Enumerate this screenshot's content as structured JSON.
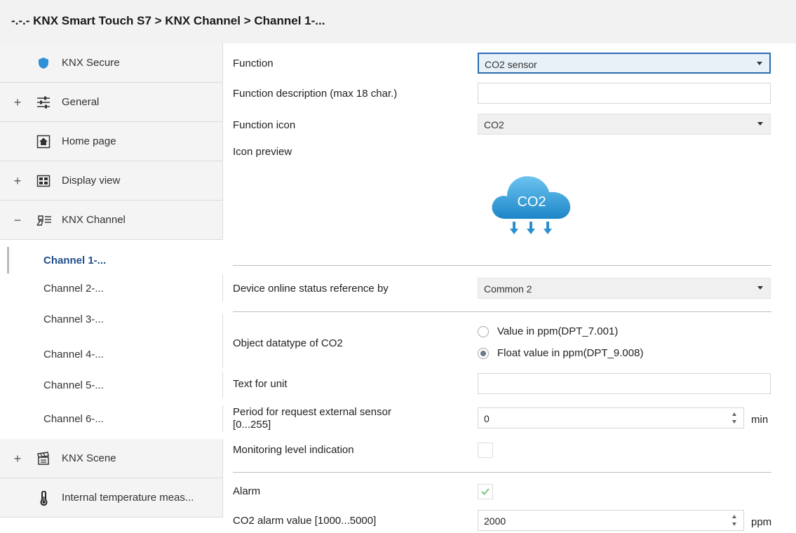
{
  "breadcrumb": "-.-.- KNX Smart Touch S7 > KNX Channel  > Channel 1-...",
  "sidebar": {
    "items": [
      {
        "label": "KNX Secure",
        "expander": ""
      },
      {
        "label": "General",
        "expander": "+"
      },
      {
        "label": "Home page",
        "expander": ""
      },
      {
        "label": "Display view",
        "expander": "+"
      },
      {
        "label": "KNX Channel",
        "expander": "−"
      }
    ],
    "channels": [
      "Channel 1-...",
      "Channel 2-...",
      "Channel 3-...",
      "Channel 4-...",
      "Channel 5-...",
      "Channel 6-..."
    ],
    "bottom_items": [
      {
        "label": "KNX Scene",
        "expander": "+"
      },
      {
        "label": "Internal temperature meas...",
        "expander": ""
      }
    ]
  },
  "main": {
    "function_label": "Function",
    "function_value": "CO2 sensor",
    "function_desc_label": "Function description (max 18 char.)",
    "function_desc_value": "",
    "function_icon_label": "Function icon",
    "function_icon_value": "CO2",
    "icon_preview_label": "Icon preview",
    "icon_preview_text": "CO2",
    "online_status_label": "Device online status reference by",
    "online_status_value": "Common 2",
    "datatype_label": "Object datatype of CO2",
    "datatype_options": [
      "Value in ppm(DPT_7.001)",
      "Float value in ppm(DPT_9.008)"
    ],
    "datatype_selected": 1,
    "unit_text_label": "Text for unit",
    "unit_text_value": "",
    "period_label_line1": "Period for request external sensor",
    "period_label_line2": "[0...255]",
    "period_value": "0",
    "period_unit": "min",
    "monitoring_label": "Monitoring level indication",
    "monitoring_checked": false,
    "alarm_label": "Alarm",
    "alarm_checked": true,
    "alarm_value_label": "CO2 alarm value [1000...5000]",
    "alarm_value": "2000",
    "alarm_unit": "ppm"
  },
  "colors": {
    "active_channel": "#1f4e8c",
    "focus_border": "#2b6cb0",
    "cloud": "#2f9fdc",
    "check": "#7cc47f"
  }
}
